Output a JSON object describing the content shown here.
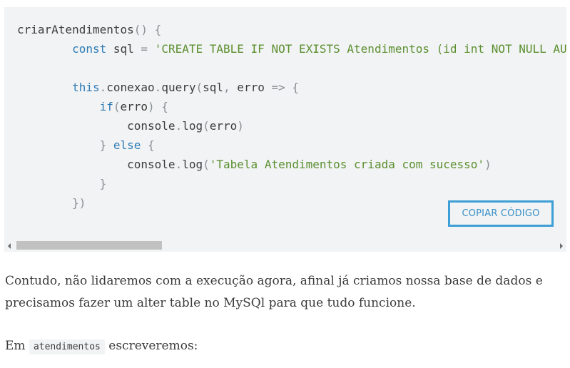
{
  "code": {
    "lines": [
      [
        {
          "t": "id",
          "v": "criarAtendimentos"
        },
        {
          "t": "pun",
          "v": "() {"
        }
      ],
      [
        {
          "t": "id",
          "v": "        "
        },
        {
          "t": "kw",
          "v": "const"
        },
        {
          "t": "id",
          "v": " sql "
        },
        {
          "t": "pun",
          "v": "="
        },
        {
          "t": "id",
          "v": " "
        },
        {
          "t": "str",
          "v": "'CREATE TABLE IF NOT EXISTS Atendimentos (id int NOT NULL AUTO_INCREMENT, cliente varchar(50) NOT NULL, pet varchar(20), servico varchar(20) NOT NULL, status varchar(20) NOT NULL, observacoes text, PRIMARY KEY(id))'"
        }
      ],
      [],
      [
        {
          "t": "id",
          "v": "        "
        },
        {
          "t": "kw",
          "v": "this"
        },
        {
          "t": "pun",
          "v": "."
        },
        {
          "t": "id",
          "v": "conexao"
        },
        {
          "t": "pun",
          "v": "."
        },
        {
          "t": "id",
          "v": "query"
        },
        {
          "t": "pun",
          "v": "("
        },
        {
          "t": "id",
          "v": "sql"
        },
        {
          "t": "pun",
          "v": ","
        },
        {
          "t": "id",
          "v": " erro "
        },
        {
          "t": "pun",
          "v": "=> {"
        }
      ],
      [
        {
          "t": "id",
          "v": "            "
        },
        {
          "t": "kw",
          "v": "if"
        },
        {
          "t": "pun",
          "v": "("
        },
        {
          "t": "id",
          "v": "erro"
        },
        {
          "t": "pun",
          "v": ") {"
        }
      ],
      [
        {
          "t": "id",
          "v": "                console"
        },
        {
          "t": "pun",
          "v": "."
        },
        {
          "t": "id",
          "v": "log"
        },
        {
          "t": "pun",
          "v": "("
        },
        {
          "t": "id",
          "v": "erro"
        },
        {
          "t": "pun",
          "v": ")"
        }
      ],
      [
        {
          "t": "id",
          "v": "            "
        },
        {
          "t": "pun",
          "v": "}"
        },
        {
          "t": "id",
          "v": " "
        },
        {
          "t": "kw",
          "v": "else"
        },
        {
          "t": "id",
          "v": " "
        },
        {
          "t": "pun",
          "v": "{"
        }
      ],
      [
        {
          "t": "id",
          "v": "                console"
        },
        {
          "t": "pun",
          "v": "."
        },
        {
          "t": "id",
          "v": "log"
        },
        {
          "t": "pun",
          "v": "("
        },
        {
          "t": "str",
          "v": "'Tabela Atendimentos criada com sucesso'"
        },
        {
          "t": "pun",
          "v": ")"
        }
      ],
      [
        {
          "t": "id",
          "v": "            "
        },
        {
          "t": "pun",
          "v": "}"
        }
      ],
      [
        {
          "t": "id",
          "v": "        "
        },
        {
          "t": "pun",
          "v": "})"
        }
      ]
    ],
    "copy_label": "COPIAR CÓDIGO"
  },
  "paragraphs": {
    "p1": "Contudo, não lidaremos com a execução agora, afinal já criamos nossa base de dados e precisamos fazer um alter table no MySQl para que tudo funcione.",
    "p2_before": "Em ",
    "p2_code": "atendimentos",
    "p2_after": " escreveremos:"
  },
  "colors": {
    "code_bg": "#f1f3f4",
    "keyword": "#2e7bb5",
    "string": "#5c8f2f",
    "accent_button": "#3e9ed6"
  }
}
